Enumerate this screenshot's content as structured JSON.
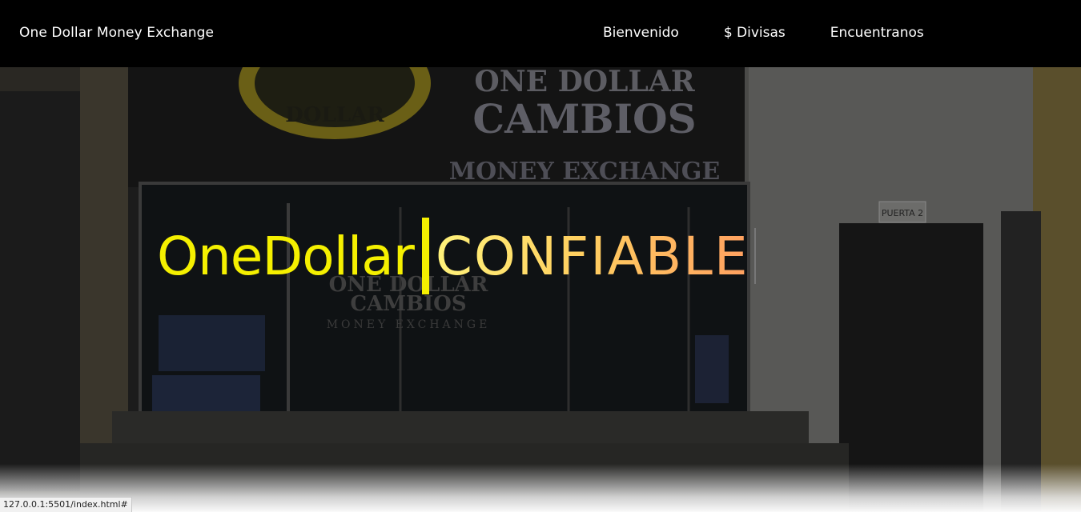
{
  "nav": {
    "brand": "One Dollar Money Exchange",
    "links": [
      "Bienvenido",
      "$ Divisas",
      "Encuentranos"
    ]
  },
  "hero": {
    "headline_static": "OneDollar",
    "headline_typed": "CONFIABLE",
    "background_signs": {
      "logo_text": "DOLLAR",
      "sign_line1": "ONE DOLLAR",
      "sign_line2": "CAMBIOS",
      "sign_line3": "MONEY EXCHANGE",
      "window_line1": "ONE DOLLAR",
      "window_line2": "CAMBIOS",
      "window_line3": "MONEY EXCHANGE",
      "door_label": "PUERTA 2"
    }
  },
  "status_bar": {
    "url": "127.0.0.1:5501/index.html#"
  },
  "colors": {
    "nav_bg": "#000000",
    "headline_yellow": "#f5f000",
    "typed_gradient_start": "#fff27a",
    "typed_gradient_end": "#ffa060"
  }
}
